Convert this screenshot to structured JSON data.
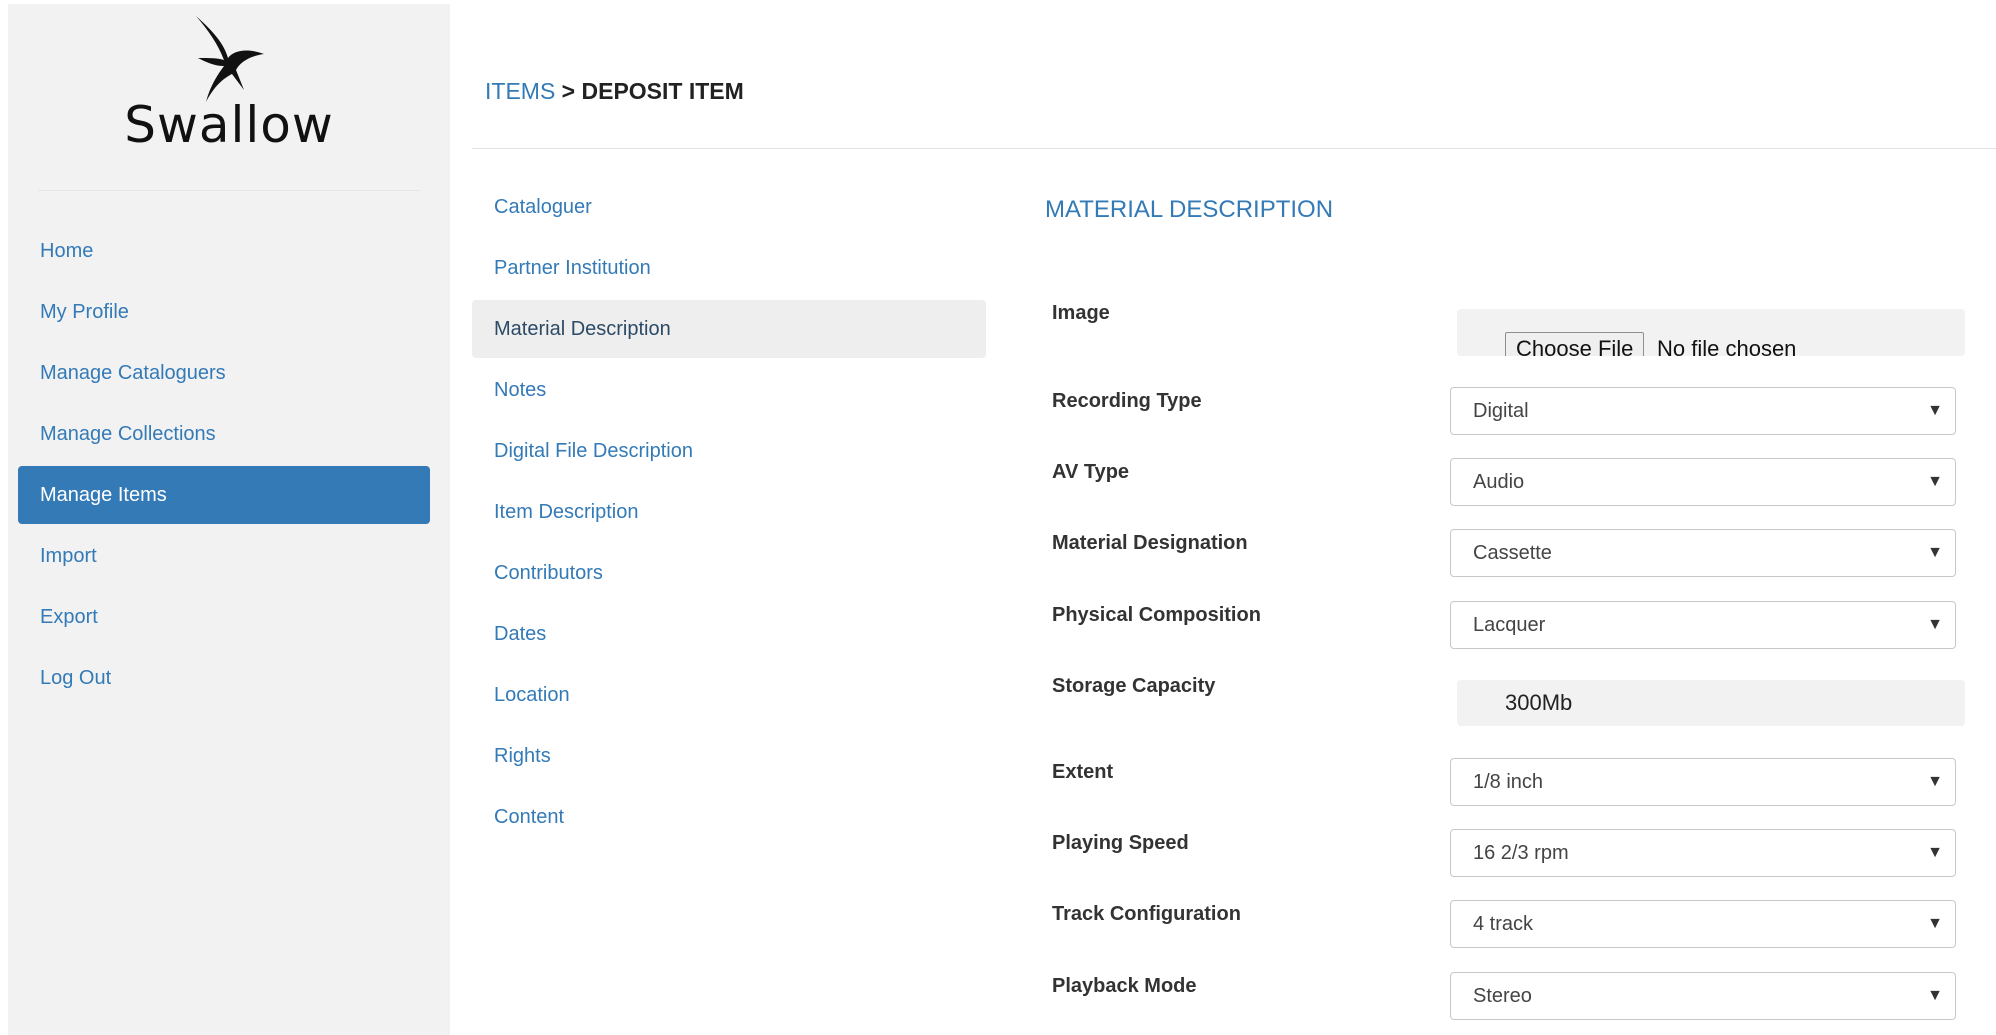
{
  "app": {
    "name": "Swallow"
  },
  "sidebar": {
    "items": [
      {
        "label": "Home"
      },
      {
        "label": "My Profile"
      },
      {
        "label": "Manage Cataloguers"
      },
      {
        "label": "Manage Collections"
      },
      {
        "label": "Manage Items",
        "active": true
      },
      {
        "label": "Import"
      },
      {
        "label": "Export"
      },
      {
        "label": "Log Out"
      }
    ]
  },
  "breadcrumb": {
    "parent": "ITEMS",
    "separator": ">",
    "current": "DEPOSIT ITEM"
  },
  "sections": {
    "items": [
      {
        "label": "Cataloguer"
      },
      {
        "label": "Partner Institution"
      },
      {
        "label": "Material Description",
        "active": true
      },
      {
        "label": "Notes"
      },
      {
        "label": "Digital File Description"
      },
      {
        "label": "Item Description"
      },
      {
        "label": "Contributors"
      },
      {
        "label": "Dates"
      },
      {
        "label": "Location"
      },
      {
        "label": "Rights"
      },
      {
        "label": "Content"
      }
    ]
  },
  "form": {
    "title": "MATERIAL DESCRIPTION",
    "image": {
      "label": "Image",
      "button": "Choose File",
      "status": "No file chosen"
    },
    "recording_type": {
      "label": "Recording Type",
      "value": "Digital"
    },
    "av_type": {
      "label": "AV Type",
      "value": "Audio"
    },
    "material_designation": {
      "label": "Material Designation",
      "value": "Cassette"
    },
    "physical_composition": {
      "label": "Physical Composition",
      "value": "Lacquer"
    },
    "storage_capacity": {
      "label": "Storage Capacity",
      "value": "300Mb"
    },
    "extent": {
      "label": "Extent",
      "value": "1/8 inch"
    },
    "playing_speed": {
      "label": "Playing Speed",
      "value": "16 2/3 rpm"
    },
    "track_configuration": {
      "label": "Track Configuration",
      "value": "4 track"
    },
    "playback_mode": {
      "label": "Playback Mode",
      "value": "Stereo"
    },
    "caret_glyph": "▼"
  },
  "colors": {
    "accent": "#337ab7",
    "sidebar_bg": "#f2f2f2",
    "active_section_bg": "#eeeeee"
  }
}
